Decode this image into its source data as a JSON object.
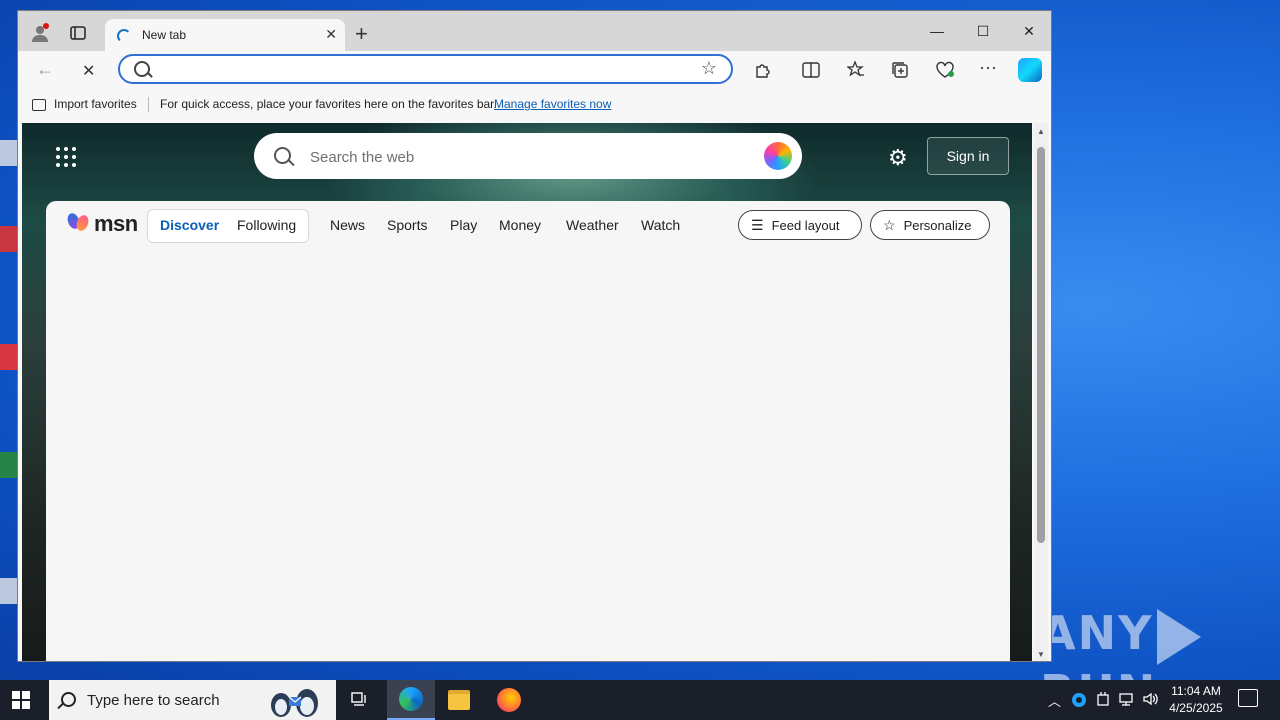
{
  "browser": {
    "tab": {
      "title": "New tab"
    },
    "window_controls": {
      "minimize": "—",
      "maximize": "☐",
      "close": "✕"
    },
    "address_bar": {
      "value": "",
      "placeholder": ""
    },
    "favorites_bar": {
      "import_label": "Import favorites",
      "message": "For quick access, place your favorites here on the favorites bar.",
      "manage_link": "Manage favorites now"
    }
  },
  "msn_page": {
    "search": {
      "placeholder": "Search the web"
    },
    "sign_in_label": "Sign in",
    "logo_text": "msn",
    "pills": [
      "Discover",
      "Following"
    ],
    "nav_links": [
      "News",
      "Sports",
      "Play",
      "Money",
      "Weather",
      "Watch"
    ],
    "feed_layout_label": "Feed layout",
    "personalize_label": "Personalize"
  },
  "taskbar": {
    "search_placeholder": "Type here to search",
    "time": "11:04 AM",
    "date": "4/25/2025"
  },
  "watermark": {
    "left": "ANY",
    "right": "RUN"
  },
  "icons": {
    "profile": "profile-icon",
    "tab_actions": "tab-actions-icon",
    "back": "back-arrow-icon",
    "stop": "stop-loading-icon",
    "favorites_star": "star-icon",
    "extensions": "puzzle-icon",
    "split": "split-screen-icon",
    "favorites": "favorites-icon",
    "collections": "collections-icon",
    "performance": "heartbeat-icon",
    "more": "ellipsis-icon",
    "copilot": "copilot-icon"
  }
}
